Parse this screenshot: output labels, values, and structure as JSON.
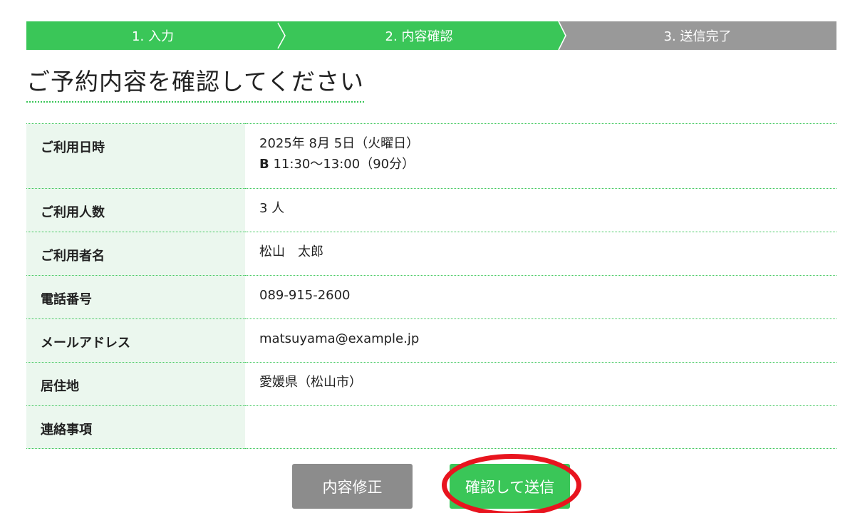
{
  "colors": {
    "accent_green": "#3ac658",
    "step_inactive": "#999999",
    "label_bg": "#ebf7ee",
    "edit_button": "#8c8c8c",
    "highlight_red": "#e8141e"
  },
  "steps": [
    {
      "label": "1. 入力",
      "state": "done"
    },
    {
      "label": "2. 内容確認",
      "state": "current"
    },
    {
      "label": "3. 送信完了",
      "state": "pending"
    }
  ],
  "heading": "ご予約内容を確認してください",
  "rows": {
    "date": {
      "label": "ご利用日時",
      "value_line1": "2025年 8月 5日（火曜日）",
      "slot_code": "B",
      "slot_time": " 11:30〜13:00（90分）"
    },
    "people": {
      "label": "ご利用人数",
      "value": "3 人"
    },
    "name": {
      "label": "ご利用者名",
      "value": "松山　太郎"
    },
    "phone": {
      "label": "電話番号",
      "value": "089-915-2600"
    },
    "email": {
      "label": "メールアドレス",
      "value": "matsuyama@example.jp"
    },
    "residence": {
      "label": "居住地",
      "value": "愛媛県（松山市）"
    },
    "notes": {
      "label": "連絡事項",
      "value": ""
    }
  },
  "buttons": {
    "edit_label": "内容修正",
    "submit_label": "確認して送信"
  },
  "highlight": {
    "target": "submit-button",
    "shape": "ellipse",
    "color": "#e8141e"
  }
}
